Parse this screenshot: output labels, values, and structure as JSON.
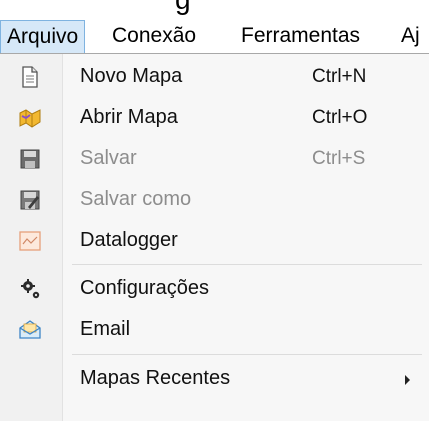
{
  "title_fragment": "g",
  "menubar": {
    "items": [
      {
        "label": "Arquivo",
        "active": true
      },
      {
        "label": "Conexão",
        "active": false
      },
      {
        "label": "Ferramentas",
        "active": false
      },
      {
        "label": "Aj",
        "active": false
      }
    ]
  },
  "menu": {
    "items": [
      {
        "label": "Novo Mapa",
        "shortcut": "Ctrl+N",
        "icon": "new-document-icon",
        "disabled": false
      },
      {
        "label": "Abrir Mapa",
        "shortcut": "Ctrl+O",
        "icon": "open-folder-icon",
        "disabled": false
      },
      {
        "label": "Salvar",
        "shortcut": "Ctrl+S",
        "icon": "save-icon",
        "disabled": true
      },
      {
        "label": "Salvar como",
        "shortcut": "",
        "icon": "save-as-icon",
        "disabled": true
      },
      {
        "label": "Datalogger",
        "shortcut": "",
        "icon": "datalogger-chart-icon",
        "disabled": false
      },
      {
        "label": "Configurações",
        "shortcut": "",
        "icon": "settings-gears-icon",
        "disabled": false
      },
      {
        "label": "Email",
        "shortcut": "",
        "icon": "email-envelope-icon",
        "disabled": false
      },
      {
        "label": "Mapas Recentes",
        "shortcut": "",
        "icon": "",
        "disabled": false,
        "has_submenu": true
      }
    ]
  },
  "colors": {
    "active_menu_bg": "#d6e8f8",
    "active_menu_border": "#7fb3e0",
    "disabled_text": "#8d8d8d"
  }
}
